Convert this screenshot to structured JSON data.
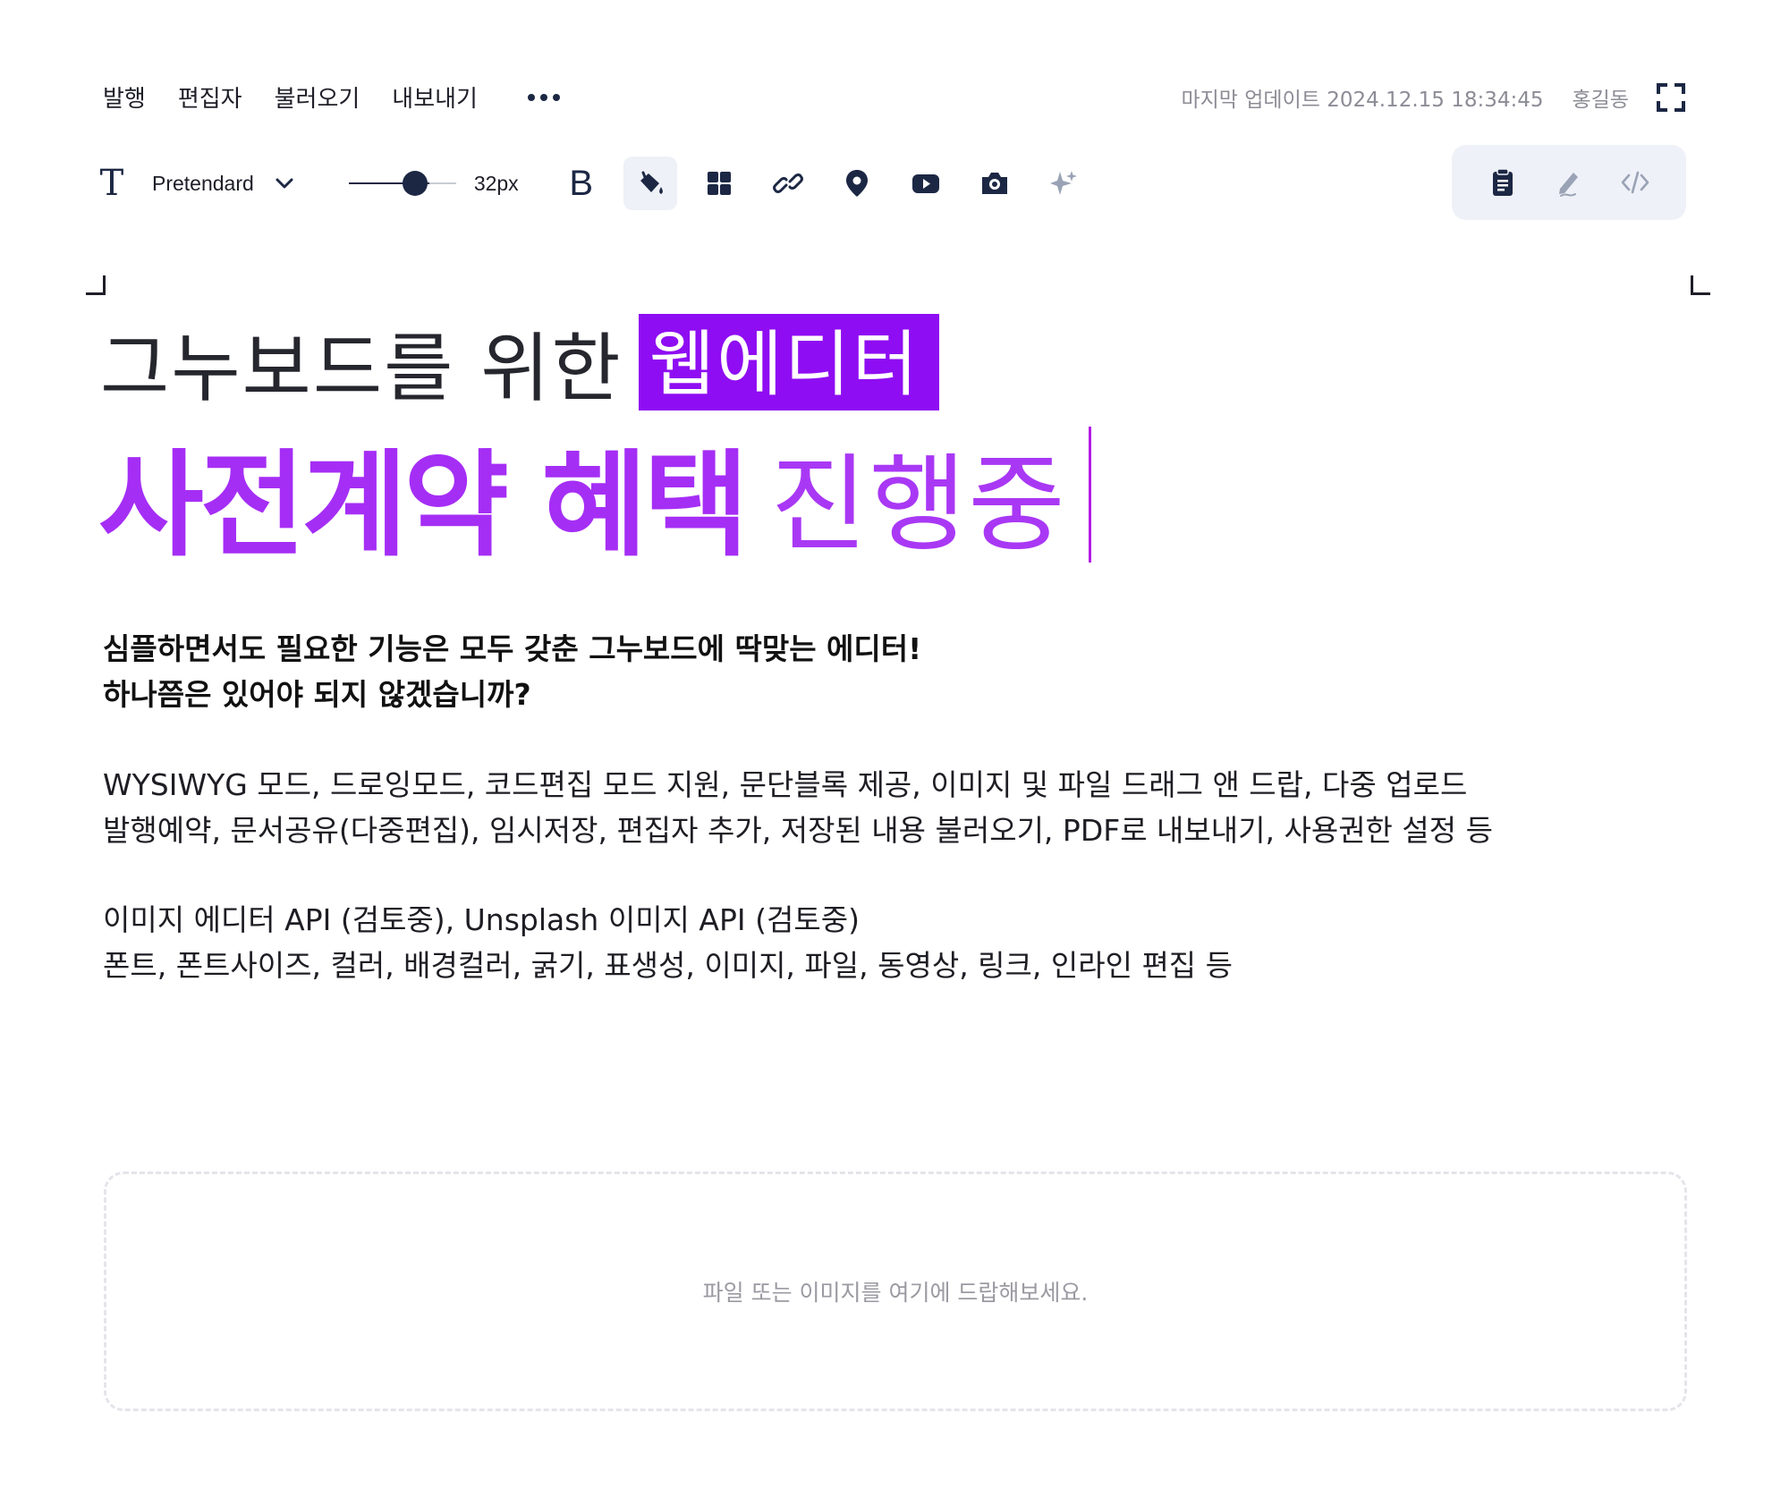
{
  "menu": {
    "items": [
      "발행",
      "편집자",
      "불러오기",
      "내보내기"
    ],
    "more_icon": "more-horizontal-icon"
  },
  "meta": {
    "updated": "마지막 업데이트 2024.12.15 18:34:45",
    "user": "홍길동",
    "fullscreen_icon": "fullscreen-icon"
  },
  "toolbar": {
    "font_icon_glyph": "T",
    "font_name": "Pretendard",
    "font_size": "32px",
    "font_size_value": 32,
    "bold_glyph": "B",
    "buttons": [
      "bold-icon",
      "paint-bucket-icon",
      "block-grid-icon",
      "link-icon",
      "location-pin-icon",
      "youtube-play-icon",
      "camera-icon",
      "sparkle-icon"
    ],
    "active_button": "paint-bucket-icon"
  },
  "mode_switch": {
    "modes": [
      "clipboard-icon",
      "pen-icon",
      "code-icon"
    ]
  },
  "colors": {
    "accent_purple": "#a52ef5",
    "highlight_purple": "#8f0df2",
    "navy": "#1c2744"
  },
  "content": {
    "heading1_light": "그누보드를 위한",
    "heading1_highlight": "웹에디터",
    "heading2_bold": "사전계약 혜택",
    "heading2_light": "진행중",
    "strong_lines": [
      "심플하면서도 필요한 기능은 모두 갖춘 그누보드에 딱맞는 에디터!",
      "하나쯤은 있어야 되지 않겠습니까?"
    ],
    "paragraph1": [
      "WYSIWYG 모드, 드로잉모드, 코드편집 모드 지원, 문단블록 제공, 이미지 및 파일 드래그 앤 드랍, 다중 업로드",
      "발행예약, 문서공유(다중편집), 임시저장, 편집자 추가, 저장된 내용 불러오기, PDF로 내보내기, 사용권한 설정 등"
    ],
    "paragraph2": [
      "이미지 에디터 API (검토중), Unsplash 이미지 API (검토중)",
      "폰트, 폰트사이즈, 컬러, 배경컬러, 굵기, 표생성, 이미지, 파일, 동영상, 링크, 인라인 편집 등"
    ]
  },
  "dropzone": {
    "text": "파일 또는 이미지를 여기에 드랍해보세요."
  }
}
